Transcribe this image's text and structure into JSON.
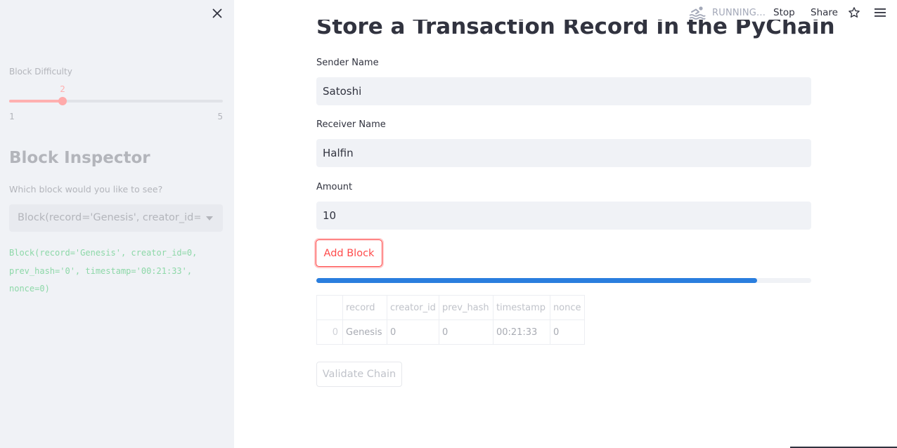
{
  "sidebar": {
    "difficulty_label": "Block Difficulty",
    "difficulty_value": "2",
    "difficulty_min": "1",
    "difficulty_max": "5",
    "difficulty_fraction": 0.25,
    "inspector_heading": "Block Inspector",
    "inspector_question": "Which block would you like to see?",
    "select_value": "Block(record='Genesis', creator_id=...",
    "block_code": "Block(record='Genesis', creator_id=0, prev_hash='0', timestamp='00:21:33', nonce=0)"
  },
  "header": {
    "status_icon": "swimmer-icon",
    "status_text": "RUNNING...",
    "stop_label": "Stop",
    "share_label": "Share",
    "star_icon": "star-icon",
    "menu_icon": "hamburger-menu-icon"
  },
  "main": {
    "title": "Store a Transaction Record in the PyChain",
    "sender_label": "Sender Name",
    "sender_value": "Satoshi",
    "receiver_label": "Receiver Name",
    "receiver_value": "Halfin",
    "amount_label": "Amount",
    "amount_value": "10",
    "add_block_label": "Add Block",
    "progress_fraction": 0.89,
    "table": {
      "columns": [
        "",
        "record",
        "creator_id",
        "prev_hash",
        "timestamp",
        "nonce"
      ],
      "rows": [
        [
          "0",
          "Genesis",
          "0",
          "0",
          "00:21:33",
          "0"
        ]
      ]
    },
    "validate_label": "Validate Chain"
  },
  "colors": {
    "accent": "#ff4b4b",
    "progress": "#2a7ede",
    "sidebar_bg": "#f0f2f6"
  }
}
